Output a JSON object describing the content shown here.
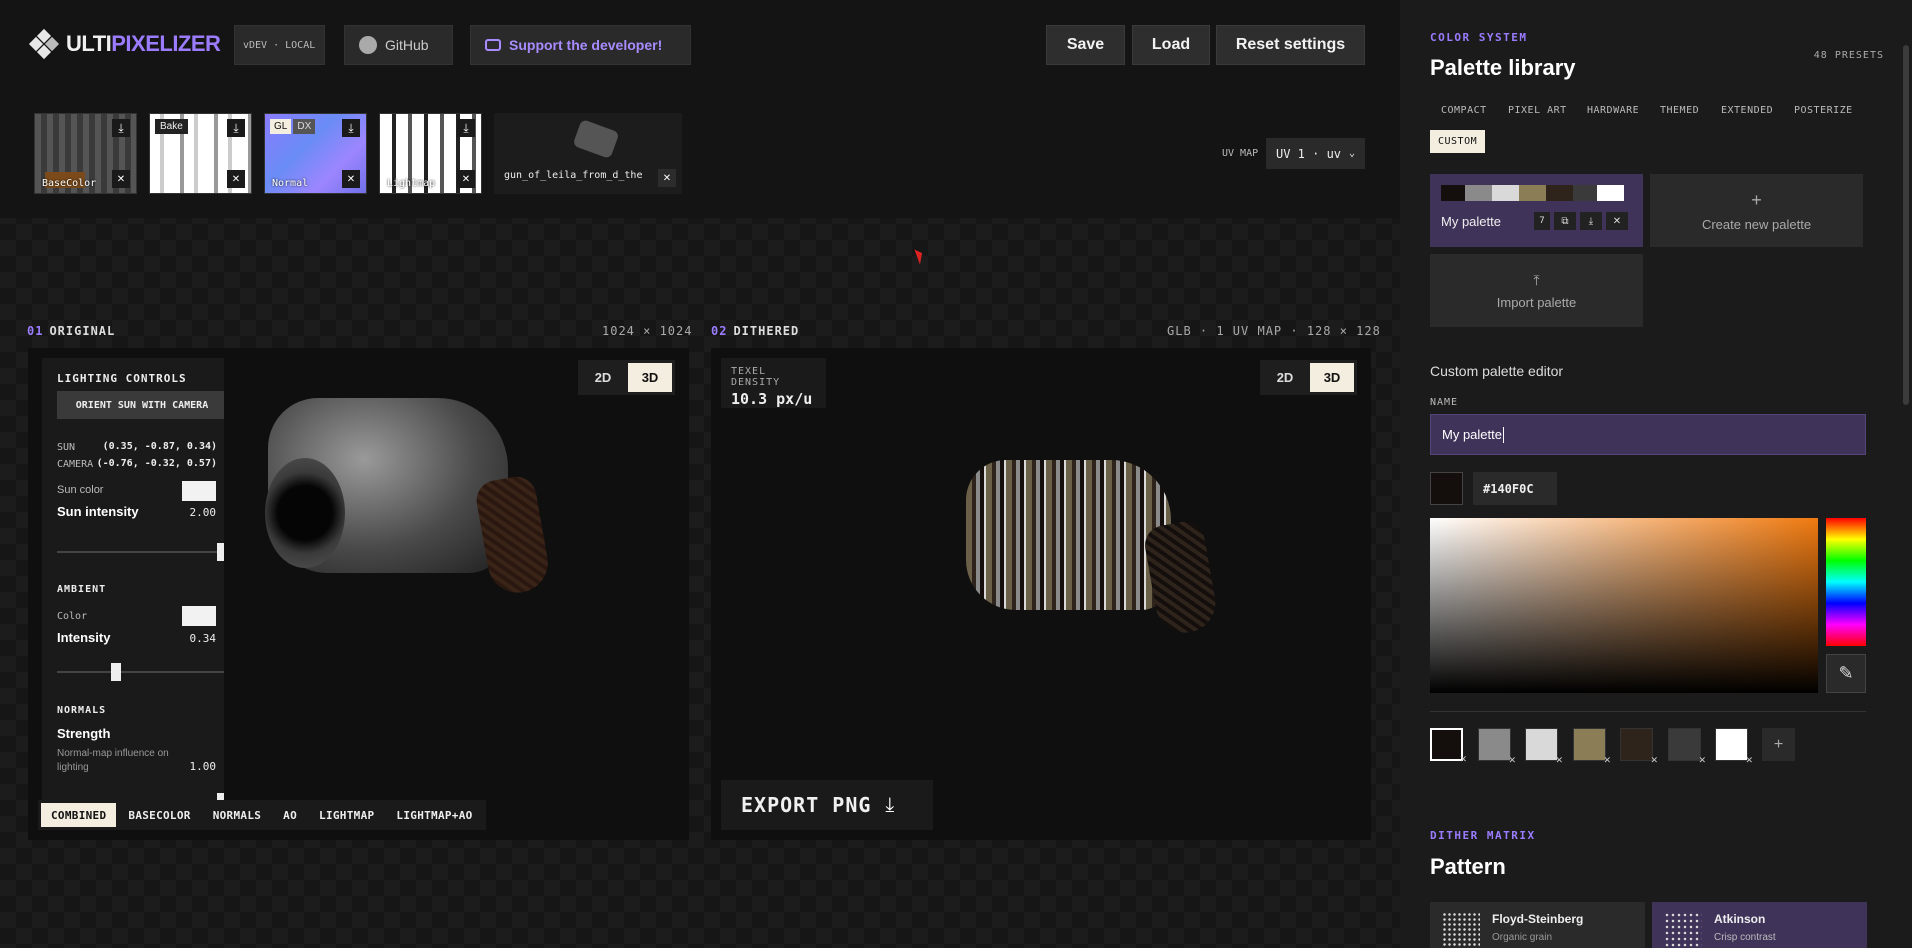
{
  "app": {
    "logo_a": "ULTI",
    "logo_b": "PIXELIZER",
    "env": "vDEV · LOCAL",
    "github": "GitHub",
    "support": "Support the developer!",
    "save": "Save",
    "load": "Load",
    "reset": "Reset settings"
  },
  "textures": [
    {
      "label": "BaseColor",
      "tag": ""
    },
    {
      "label": "",
      "tag": "Bake"
    },
    {
      "label": "Normal",
      "tag": "GL"
    },
    {
      "label": "Lightmap",
      "tag": ""
    }
  ],
  "texture_extra": {
    "tag2": "DX"
  },
  "model": {
    "name": "gun_of_leila_from_d_the"
  },
  "uv": {
    "label": "UV MAP",
    "value": "UV 1 · uv"
  },
  "original": {
    "num": "01",
    "title": "ORIGINAL",
    "meta": "1024 × 1024",
    "t2d": "2D",
    "t3d": "3D"
  },
  "dithered": {
    "num": "02",
    "title": "DITHERED",
    "meta": "GLB · 1 UV MAP · 128 × 128",
    "t2d": "2D",
    "t3d": "3D",
    "density_label": "TEXEL DENSITY",
    "density_value": "10.3 px/u",
    "export": "EXPORT PNG"
  },
  "lighting": {
    "title": "LIGHTING CONTROLS",
    "orient": "ORIENT SUN WITH CAMERA",
    "sun_label": "SUN",
    "sun_value": "(0.35, -0.87, 0.34)",
    "cam_label": "CAMERA",
    "cam_value": "(-0.76, -0.32, 0.57)",
    "sun_color": "Sun color",
    "sun_intensity": "Sun intensity",
    "sun_intensity_value": "2.00",
    "ambient": "AMBIENT",
    "color": "Color",
    "intensity": "Intensity",
    "intensity_value": "0.34",
    "normals": "NORMALS",
    "strength": "Strength",
    "strength_desc": "Normal-map influence on lighting",
    "strength_value": "1.00"
  },
  "view_tabs": [
    "COMBINED",
    "BASECOLOR",
    "NORMALS",
    "AO",
    "LIGHTMAP",
    "LIGHTMAP+AO"
  ],
  "sidebar": {
    "color_system": "COLOR SYSTEM",
    "palette_library": "Palette library",
    "presets": "48 PRESETS",
    "categories": [
      "COMPACT",
      "PIXEL ART",
      "HARDWARE",
      "THEMED",
      "EXTENDED",
      "POSTERIZE",
      "CUSTOM"
    ],
    "my_palette": "My palette",
    "my_palette_count": "7",
    "create": "Create new palette",
    "import": "Import palette",
    "editor": "Custom palette editor",
    "name_label": "NAME",
    "name_value": "My palette",
    "hex": "#140F0C",
    "swatches": [
      "#140f0c",
      "#8a8a8a",
      "#d9d9d9",
      "#8b7d55",
      "#2e241c",
      "#3a3a3a",
      "#ffffff"
    ],
    "dither_matrix": "DITHER MATRIX",
    "pattern": "Pattern",
    "patterns": [
      {
        "name": "Floyd-Steinberg",
        "desc": "Organic grain"
      },
      {
        "name": "Atkinson",
        "desc": "Crisp contrast"
      }
    ]
  }
}
